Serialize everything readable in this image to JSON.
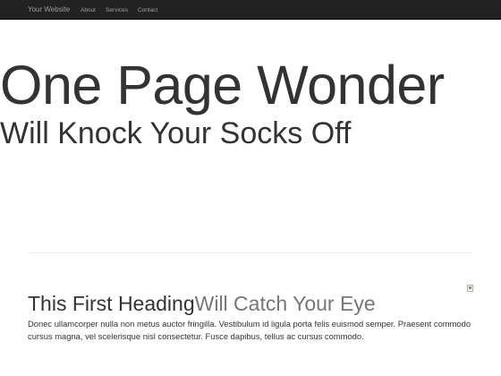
{
  "navbar": {
    "brand": "Your Website",
    "items": [
      {
        "label": "About"
      },
      {
        "label": "Services"
      },
      {
        "label": "Contact"
      }
    ]
  },
  "hero": {
    "title": "One Page Wonder",
    "subtitle": "Will Knock Your Socks Off"
  },
  "featurette": {
    "heading": "This First Heading",
    "heading_muted": "Will Catch Your Eye",
    "lead": "Donec ullamcorper nulla non metus auctor fringilla. Vestibulum id ligula porta felis euismod semper. Praesent commodo cursus magna, vel scelerisque nisl consectetur. Fusce dapibus, tellus ac cursus commodo.",
    "image_icon": "broken-image-icon"
  },
  "colors": {
    "navbar_bg": "#222222",
    "nav_text": "#9d9d9d",
    "text": "#333333",
    "muted_text": "#777777"
  }
}
